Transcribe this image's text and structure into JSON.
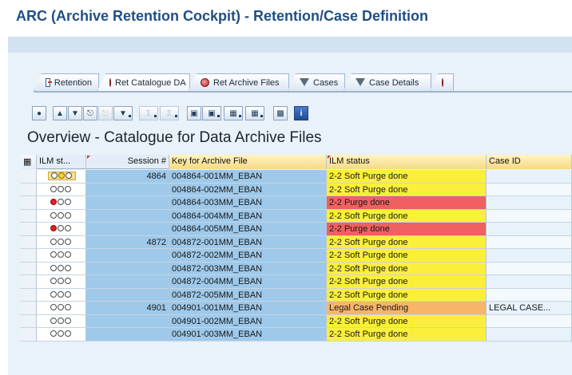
{
  "window": {
    "title": "ARC (Archive Retention Cockpit) - Retention/Case Definition"
  },
  "tabs": [
    {
      "label": "Retention",
      "icon": "document-icon"
    },
    {
      "label": "Ret Catalogue DA",
      "icon": "disc-icon"
    },
    {
      "label": "Ret Archive Files",
      "icon": "disc-icon"
    },
    {
      "label": "Cases",
      "icon": "filter-icon"
    },
    {
      "label": "Case Details",
      "icon": "filter-icon"
    }
  ],
  "toolbar": {
    "buttons": [
      "details-icon",
      "print-icon",
      "filter-icon",
      "find-icon",
      "find-next-icon",
      "set-filter-icon",
      "sum-icon",
      "subtotal-icon",
      "export-icon",
      "layout-icon",
      "views-icon",
      "spreadsheet-icon",
      "graphic-icon",
      "info-icon"
    ]
  },
  "overview": {
    "title": "Overview - Catalogue for Data Archive Files"
  },
  "grid": {
    "columns": [
      "ILM st...",
      "Session #",
      "Key for Archive File",
      "ILM status",
      "Case ID"
    ],
    "rows": [
      {
        "light": "yellow",
        "session": "4864",
        "key": "004864-001MM_EBAN",
        "status": "2-2 Soft Purge done",
        "status_color": "yellow",
        "case": ""
      },
      {
        "light": "off",
        "session": "",
        "key": "004864-002MM_EBAN",
        "status": "2-2 Soft Purge done",
        "status_color": "yellow",
        "case": ""
      },
      {
        "light": "red",
        "session": "",
        "key": "004864-003MM_EBAN",
        "status": "2-2 Purge done",
        "status_color": "red",
        "case": ""
      },
      {
        "light": "off",
        "session": "",
        "key": "004864-004MM_EBAN",
        "status": "2-2 Soft Purge done",
        "status_color": "yellow",
        "case": ""
      },
      {
        "light": "red",
        "session": "",
        "key": "004864-005MM_EBAN",
        "status": "2-2 Purge done",
        "status_color": "red",
        "case": ""
      },
      {
        "light": "off",
        "session": "4872",
        "key": "004872-001MM_EBAN",
        "status": "2-2 Soft Purge done",
        "status_color": "yellow",
        "case": ""
      },
      {
        "light": "off",
        "session": "",
        "key": "004872-002MM_EBAN",
        "status": "2-2 Soft Purge done",
        "status_color": "yellow",
        "case": ""
      },
      {
        "light": "off",
        "session": "",
        "key": "004872-003MM_EBAN",
        "status": "2-2 Soft Purge done",
        "status_color": "yellow",
        "case": ""
      },
      {
        "light": "off",
        "session": "",
        "key": "004872-004MM_EBAN",
        "status": "2-2 Soft Purge done",
        "status_color": "yellow",
        "case": ""
      },
      {
        "light": "off",
        "session": "",
        "key": "004872-005MM_EBAN",
        "status": "2-2 Soft Purge done",
        "status_color": "yellow",
        "case": ""
      },
      {
        "light": "off",
        "session": "4901",
        "key": "004901-001MM_EBAN",
        "status": "Legal Case Pending",
        "status_color": "orange",
        "case": "LEGAL CASE..."
      },
      {
        "light": "off",
        "session": "",
        "key": "004901-002MM_EBAN",
        "status": "2-2 Soft Purge done",
        "status_color": "yellow",
        "case": ""
      },
      {
        "light": "off",
        "session": "",
        "key": "004901-003MM_EBAN",
        "status": "2-2 Soft Purge done",
        "status_color": "yellow",
        "case": ""
      }
    ]
  },
  "colors": {
    "title": "#1f4f84",
    "soft_purge": "#fbef3b",
    "purge": "#ef6060",
    "legal_case": "#f6b56a",
    "key_columns": "#9ec9ea"
  }
}
